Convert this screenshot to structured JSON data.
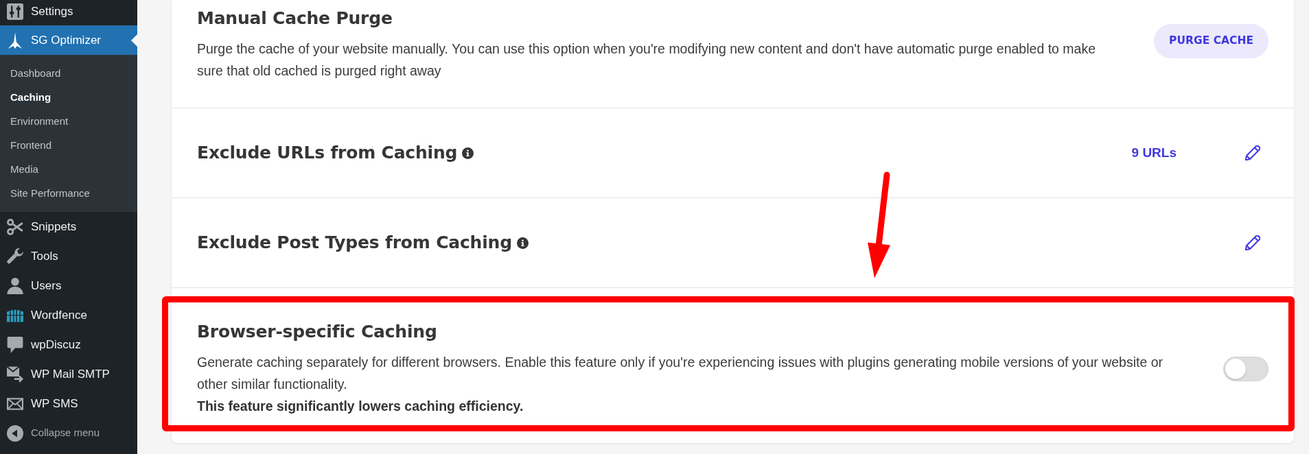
{
  "sidebar": {
    "items": [
      {
        "label": "Settings",
        "selected": false
      },
      {
        "label": "SG Optimizer",
        "selected": true,
        "children": [
          {
            "label": "Dashboard",
            "selected": false
          },
          {
            "label": "Caching",
            "selected": true
          },
          {
            "label": "Environment",
            "selected": false
          },
          {
            "label": "Frontend",
            "selected": false
          },
          {
            "label": "Media",
            "selected": false
          },
          {
            "label": "Site Performance",
            "selected": false
          }
        ]
      },
      {
        "label": "Snippets",
        "selected": false
      },
      {
        "label": "Tools",
        "selected": false
      },
      {
        "label": "Users",
        "selected": false
      },
      {
        "label": "Wordfence",
        "selected": false
      },
      {
        "label": "wpDiscuz",
        "selected": false
      },
      {
        "label": "WP Mail SMTP",
        "selected": false
      },
      {
        "label": "WP SMS",
        "selected": false
      }
    ],
    "collapse_menu": {
      "label": "Collapse menu"
    }
  },
  "cache_settings": [
    {
      "kind": "action",
      "title": "Manual Cache Purge",
      "description": "Purge the cache of your website manually. You can use this option when you're modifying new content and don't have automatic purge enabled to make sure that old cached is purged right away",
      "button": "PURGE CACHE"
    },
    {
      "kind": "list",
      "title": "Exclude URLs from Caching",
      "info": true,
      "count": "9 URLs"
    },
    {
      "kind": "list",
      "title": "Exclude Post Types from Caching",
      "info": true
    },
    {
      "kind": "toggle",
      "title": "Browser-specific Caching",
      "description": "Generate caching separately for different browsers. Enable this feature only if you're experiencing issues with plugins generating mobile versions of your website or other similar functionality.",
      "warning": "This feature significantly lowers caching efficiency.",
      "on": false,
      "highlighted": true
    }
  ]
}
